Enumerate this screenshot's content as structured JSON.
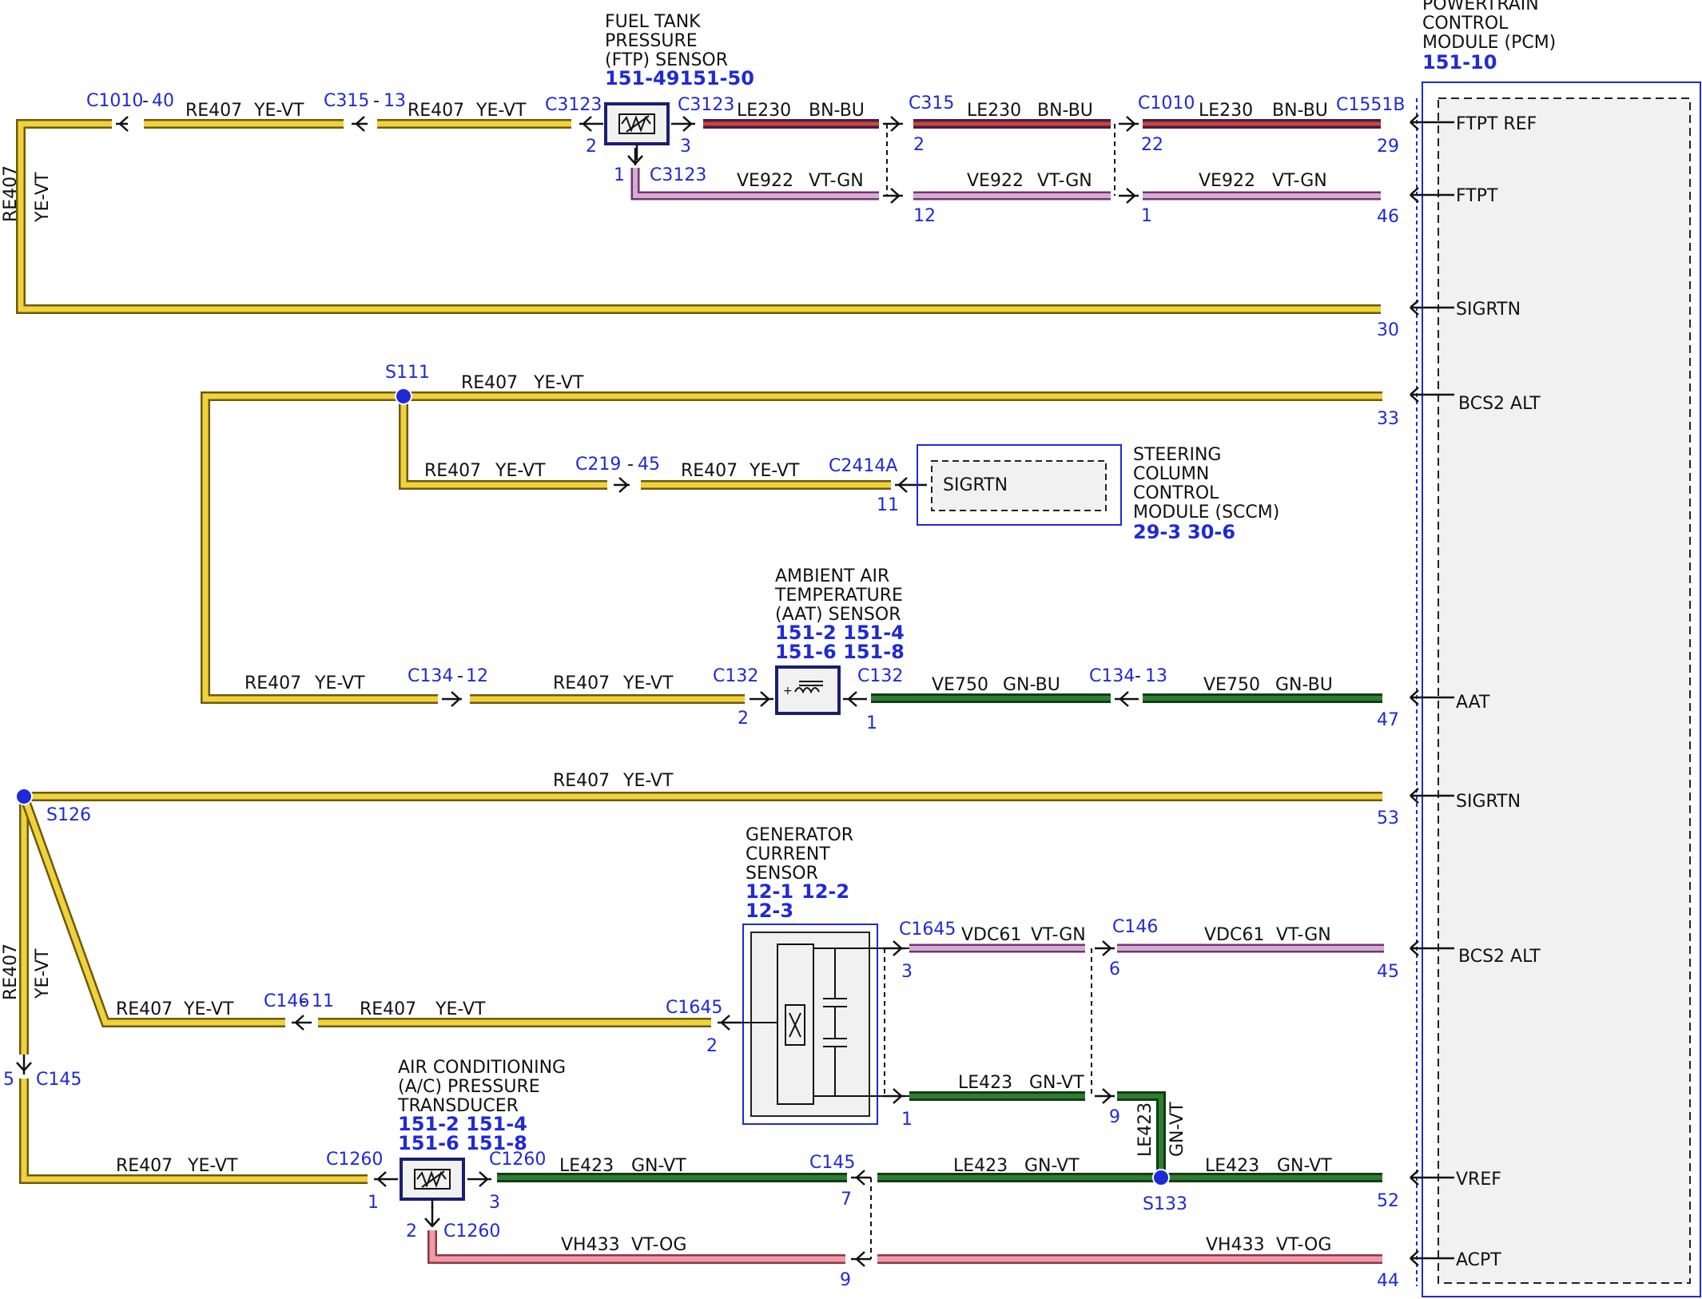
{
  "pcm": {
    "title_lines": [
      "POWERTRAIN",
      "CONTROL",
      "MODULE (PCM)"
    ],
    "ref": "151-10",
    "pins": [
      {
        "label": "FTPT REF",
        "pin": "29"
      },
      {
        "label": "FTPT",
        "pin": "46"
      },
      {
        "label": "SIGRTN",
        "pin": "30"
      },
      {
        "label": "BCS2 ALT",
        "pin": "33"
      },
      {
        "label": "AAT",
        "pin": "47"
      },
      {
        "label": "SIGRTN",
        "pin": "53"
      },
      {
        "label": "BCS2 ALT",
        "pin": "45"
      },
      {
        "label": "VREF",
        "pin": "52"
      },
      {
        "label": "ACPT",
        "pin": "44"
      }
    ]
  },
  "ftp_sensor": {
    "title_lines": [
      "FUEL TANK",
      "PRESSURE",
      "(FTP) SENSOR"
    ],
    "refs": "151-49151-50"
  },
  "sccm": {
    "title_lines": [
      "STEERING",
      "COLUMN",
      "CONTROL",
      "MODULE (SCCM)"
    ],
    "refs": [
      "29-3",
      "30-6"
    ],
    "pin_label": "SIGRTN"
  },
  "aat_sensor": {
    "title_lines": [
      "AMBIENT AIR",
      "TEMPERATURE",
      "(AAT) SENSOR"
    ],
    "refs": [
      "151-2 151-4",
      "151-6 151-8"
    ]
  },
  "gen_sensor": {
    "title_lines": [
      "GENERATOR",
      "CURRENT",
      "SENSOR"
    ],
    "refs": [
      "12-1",
      "12-2",
      "12-3"
    ]
  },
  "ac_transducer": {
    "title_lines": [
      "AIR CONDITIONING",
      "(A/C) PRESSURE",
      "TRANSDUCER"
    ],
    "refs": [
      "151-2 151-4",
      "151-6 151-8"
    ]
  },
  "splices": [
    "S111",
    "S126",
    "S133"
  ],
  "connectors": {
    "c1010_40": "C1010",
    "c1010_40_pin": "40",
    "c315_13": "C315",
    "c315_13_pin": "13",
    "c3123_l": "C3123",
    "c3123_r": "C3123",
    "c3123_b": "C3123",
    "c315_r": "C315",
    "c1010_r": "C1010",
    "c1551b": "C1551B",
    "c219": "C219",
    "c219_pin": "45",
    "c2414a": "C2414A",
    "c134_12": "C134",
    "c134_12_pin": "12",
    "c132_l": "C132",
    "c132_r": "C132",
    "c134_13": "C134",
    "c134_13_pin": "13",
    "c1645_t": "C1645",
    "c146_t": "C146",
    "c146_11": "C146",
    "c146_11_pin": "11",
    "c1645_l": "C1645",
    "c145_l": "C145",
    "c1260_l": "C1260",
    "c1260_r": "C1260",
    "c1260_b": "C1260",
    "c145_m": "C145"
  },
  "wires": {
    "re407": "RE407",
    "ye_vt": "YE-VT",
    "le230": "LE230",
    "bn_bu": "BN-BU",
    "ve922": "VE922",
    "vt_gn": "VT-GN",
    "ve750": "VE750",
    "gn_bu": "GN-BU",
    "vdc61": "VDC61",
    "le423": "LE423",
    "gn_vt": "GN-VT",
    "vh433": "VH433",
    "vt_og": "VT-OG"
  },
  "pins": {
    "p2a": "2",
    "p3a": "3",
    "p1a": "1",
    "p2b": "2",
    "p22": "22",
    "p12": "12",
    "p1b": "1",
    "p11": "11",
    "p2c": "2",
    "p1c": "1",
    "p3d": "3",
    "p6": "6",
    "p2d": "2",
    "p1d": "1",
    "p9a": "9",
    "p5": "5",
    "p1e": "1",
    "p3e": "3",
    "p2e": "2",
    "p7": "7",
    "p9b": "9"
  },
  "colors": {
    "connector_blue": "#1f2ad6",
    "yellow": "#f1d23a",
    "purple": "#7b2d6b",
    "red": "#c8453c",
    "violet": "#c88fc9",
    "green": "#2e7d32",
    "pink": "#f29aa8"
  }
}
